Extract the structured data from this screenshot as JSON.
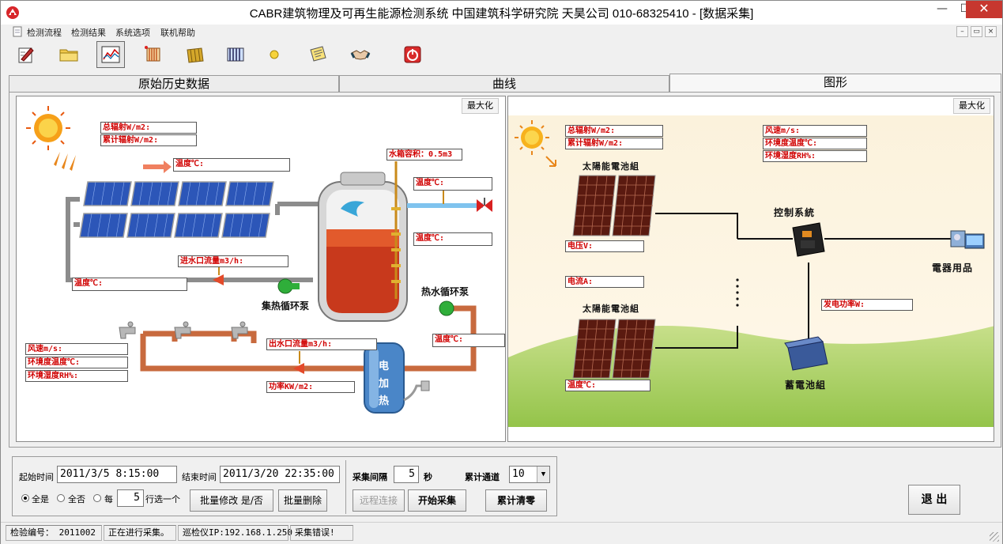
{
  "window": {
    "title": "CABR建筑物理及可再生能源检测系统      中国建筑科学研究院 天昊公司      010-68325410 - [数据采集]",
    "minimize": "—",
    "maximize": "☐",
    "close": "✕"
  },
  "menu": {
    "items": [
      "检测流程",
      "检测结果",
      "系统选项",
      "联机帮助"
    ],
    "mdi": [
      "–",
      "▭",
      "×"
    ]
  },
  "toolbar": {
    "buttons": [
      "edit-report",
      "open-folder",
      "chart",
      "radiator",
      "solar-panel",
      "collector",
      "sun-dot",
      "notepad",
      "handshake",
      "power"
    ]
  },
  "tabs": [
    "原始历史数据",
    "曲线",
    "图形"
  ],
  "left_panel": {
    "maximize": "最大化",
    "labels": {
      "total_rad": "总辐射W/m2:",
      "cum_rad": "累计辐射W/m2:",
      "panel_temp": "温度℃:",
      "tank_volume": "水箱容积：0.5m3",
      "outlet_temp": "温度℃:",
      "tank_temp": "温度℃:",
      "inlet_flow": "进水口流量m3/h:",
      "return_temp": "温度℃:",
      "hot_temp": "温度℃:",
      "outlet_flow": "出水口流量m3/h:",
      "power": "功率KW/m2:",
      "wind": "风速m/s:",
      "env_temp": "环境度温度℃:",
      "env_hum": "环境湿度RH%:"
    },
    "captions": {
      "collect_pump": "集热循环泵",
      "hot_pump": "热水循环泵",
      "heater": [
        "电",
        "加",
        "热"
      ]
    }
  },
  "right_panel": {
    "maximize": "最大化",
    "labels": {
      "total_rad": "总辐射W/m2:",
      "cum_rad": "累计辐射W/m2:",
      "wind": "风速m/s:",
      "env_temp": "环境度温度℃:",
      "env_hum": "环境湿度RH%:",
      "voltage": "电压V:",
      "current": "电流A:",
      "gen_power": "发电功率W:",
      "cell_temp": "温度℃:"
    },
    "captions": {
      "array_top": "太陽能電池組",
      "array_bottom": "太陽能電池組",
      "controller": "控制系統",
      "appliance": "電器用品",
      "battery": "蓄電池組"
    }
  },
  "controls": {
    "start_label": "起始时间",
    "start_value": "2011/3/5 8:15:00",
    "end_label": "结束时间",
    "end_value": "2011/3/20 22:35:00",
    "radio_all_yes": "全是",
    "radio_all_no": "全否",
    "radio_every": "每",
    "every_value": "5",
    "every_suffix": "行选一个",
    "batch_edit": "批量修改 是/否",
    "batch_delete": "批量删除",
    "interval_label": "采集间隔",
    "interval_value": "5",
    "interval_unit": "秒",
    "channel_label": "累计通道",
    "channel_value": "10",
    "remote_connect": "远程连接",
    "start_collect": "开始采集",
    "reset_total": "累计清零",
    "exit": "退 出"
  },
  "status": {
    "serial": "检验编号： 2011002",
    "state": "正在进行采集。",
    "ip": "巡检仪IP:192.168.1.250",
    "error": "采集错误!"
  }
}
